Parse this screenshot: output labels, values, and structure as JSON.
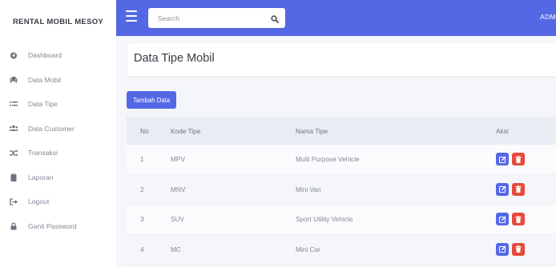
{
  "sidebar": {
    "brand": "RENTAL MOBIL MESOY",
    "items": [
      {
        "label": "Dashboard",
        "icon": "dashboard-icon"
      },
      {
        "label": "Data Mobil",
        "icon": "car-icon"
      },
      {
        "label": "Data Tipe",
        "icon": "list-icon"
      },
      {
        "label": "Data Customer",
        "icon": "users-icon"
      },
      {
        "label": "Transaksi",
        "icon": "random-icon"
      },
      {
        "label": "Laporan",
        "icon": "clipboard-icon"
      },
      {
        "label": "Logout",
        "icon": "logout-icon"
      },
      {
        "label": "Ganti Password",
        "icon": "lock-icon"
      }
    ]
  },
  "topbar": {
    "search_placeholder": "Search",
    "user_label": "ADM",
    "accent_color": "#5468e6"
  },
  "page": {
    "title": "Data Tipe Mobil",
    "add_button": "Tambah Data"
  },
  "table": {
    "headers": {
      "no": "No",
      "kode": "Kode Tipe",
      "nama": "Nama Tipe",
      "aksi": "Aksi"
    },
    "rows": [
      {
        "no": "1",
        "kode": "MPV",
        "nama": "Multi Purpose Vehicle"
      },
      {
        "no": "2",
        "kode": "MNV",
        "nama": "Mini Van"
      },
      {
        "no": "3",
        "kode": "SUV",
        "nama": "Sport Utility Vehicle"
      },
      {
        "no": "4",
        "kode": "MC",
        "nama": "Mini Car"
      }
    ],
    "edit_color": "#5468e6",
    "delete_color": "#e74a3b"
  }
}
